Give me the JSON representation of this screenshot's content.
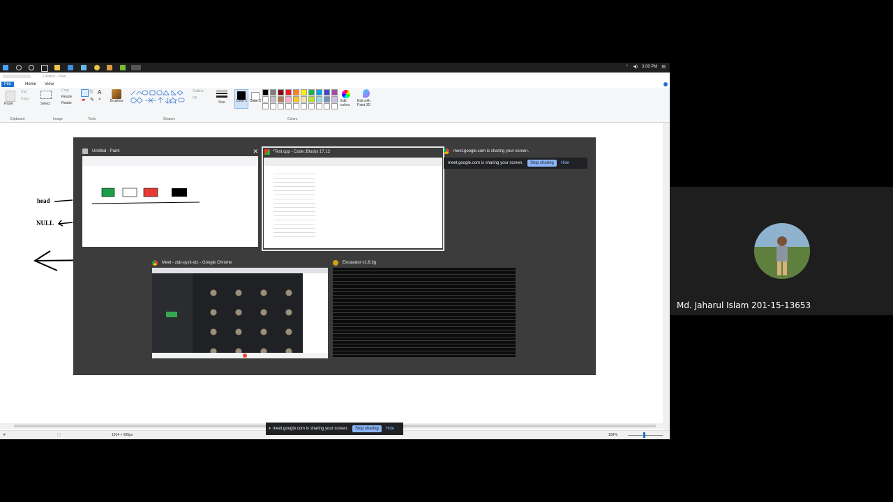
{
  "taskbar": {
    "clock": "3:08 PM"
  },
  "paint": {
    "window_title": "Untitled - Paint",
    "tabs": [
      "File",
      "Home",
      "View"
    ],
    "groups": [
      "Clipboard",
      "Image",
      "Tools",
      "Shapes",
      "Colors"
    ],
    "buttons": {
      "paste": "Paste",
      "cut": "Cut",
      "copy": "Copy",
      "select": "Select",
      "crop": "Crop",
      "resize": "Resize",
      "rotate": "Rotate",
      "brushes": "Brushes",
      "outline": "Outline",
      "fill": "Fill",
      "size": "Size",
      "color1": "Color 1",
      "color2": "Color 2",
      "edit_colors": "Edit colors",
      "paint3d": "Edit with Paint 3D"
    },
    "status_size": "1914 × 905px",
    "zoom": "100%",
    "canvas_labels": {
      "head": "head",
      "null": "NULL"
    }
  },
  "switcher": {
    "windows": [
      {
        "title": "Untitled - Paint"
      },
      {
        "title": "*Test.cpp - Code::Blocks 17.12"
      },
      {
        "title": "meet.google.com is sharing your screen."
      },
      {
        "title": "Meet - zqb-uyzk-qtc - Google Chrome"
      },
      {
        "title": "Excavator v1.6.3g"
      }
    ]
  },
  "share_bar": {
    "text": "meet.google.com is sharing your screen.",
    "stop": "Stop sharing",
    "hide": "Hide"
  },
  "meet": {
    "participant_name": "Md. Jaharul Islam 201-15-13653"
  },
  "colors": {
    "paint_red": "#e53935",
    "paint_green": "#1a9e4b",
    "accent_blue": "#8ab4f8"
  }
}
